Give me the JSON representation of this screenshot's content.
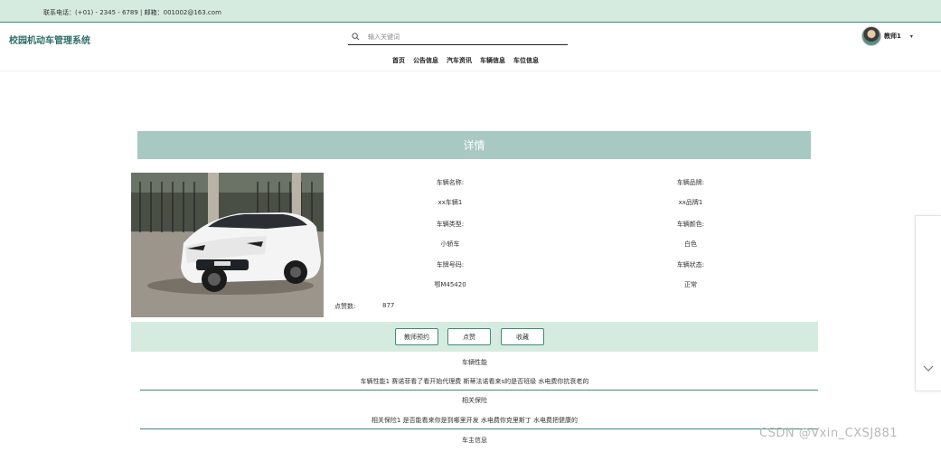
{
  "topbar": {
    "contact": "联系电话：(+01) - 2345 - 6789 | 邮箱：001002@163.com"
  },
  "header": {
    "site_title": "校园机动车管理系统",
    "search_placeholder": "输入关键词",
    "nav": [
      "首页",
      "公告信息",
      "汽车资讯",
      "车辆信息",
      "车位信息"
    ],
    "user_name": "教师1",
    "caret": "▾"
  },
  "detail": {
    "banner": "详情",
    "fields": [
      {
        "label": "车辆名称:",
        "value": "xx车辆1"
      },
      {
        "label": "车辆品牌:",
        "value": "xx品牌1"
      },
      {
        "label": "车辆类型:",
        "value": "小轿车"
      },
      {
        "label": "车辆颜色:",
        "value": "白色"
      },
      {
        "label": "车牌号码:",
        "value": "鄂M45420"
      },
      {
        "label": "车辆状态:",
        "value": "正常"
      }
    ],
    "likes_label": "点赞数:",
    "likes_value": "877"
  },
  "actions": {
    "reserve": "教师预约",
    "like": "点赞",
    "favorite": "收藏"
  },
  "sections": [
    {
      "title": "车辆性能",
      "text": "车辆性能1 赛诺菲看了看开始代理费 斯蒂法诺看来s的是否班级 水电费你抗衰老的"
    },
    {
      "title": "相关保险",
      "text": "相关保险1 是否能看来你是到哪里开发 水电费你克里斯丁 水电费把健康的"
    },
    {
      "title": "车主信息"
    }
  ],
  "watermark": "CSDN @Vxin_CXSJ881",
  "colors": {
    "accent": "#3f8a7a",
    "banner": "#a8c8c2",
    "light_green": "#d6ebdf",
    "title": "#2e6d66"
  }
}
